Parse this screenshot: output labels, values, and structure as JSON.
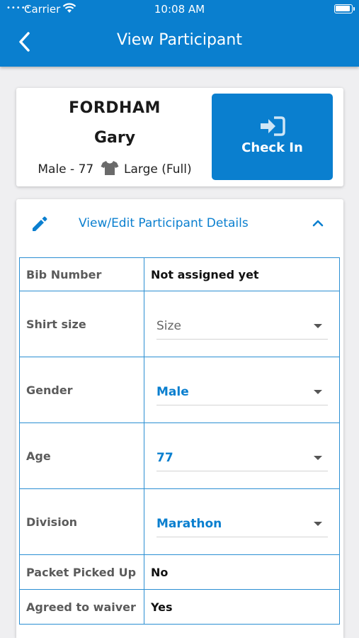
{
  "status_bar": {
    "signal": "•••••",
    "carrier": "Carrier",
    "time": "10:08 AM"
  },
  "header": {
    "title": "View Participant",
    "color": "#0a7fcf"
  },
  "participant": {
    "last_name": "FORDHAM",
    "first_name": "Gary",
    "gender_age": "Male - 77",
    "shirt_size": "Large (Full)"
  },
  "check_in": {
    "label": "Check In",
    "icon": "sign-in-icon"
  },
  "details": {
    "toggle_label": "View/Edit Participant Details",
    "icon": "pencil-icon",
    "chevron": "chevron-up-icon",
    "rows": [
      {
        "label": "Bib Number",
        "value": "Not assigned yet"
      },
      {
        "label": "Shirt size",
        "value": "Size",
        "placeholder": true
      },
      {
        "label": "Gender",
        "value": "Male"
      },
      {
        "label": "Age",
        "value": "77"
      },
      {
        "label": "Division",
        "value": "Marathon"
      },
      {
        "label": "Packet Picked Up",
        "value": "No"
      },
      {
        "label": "Agreed to waiver",
        "value": "Yes"
      }
    ]
  },
  "colors": {
    "primary": "#0a7fcf",
    "grid_border": "#2b8fd3",
    "background": "#efeff1"
  }
}
